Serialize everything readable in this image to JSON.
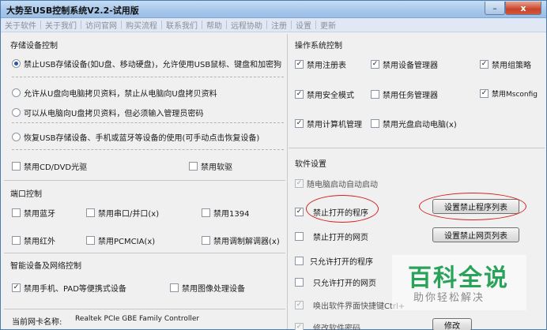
{
  "window": {
    "title": "大势至USB控制系统V2.2-试用版",
    "min_glyph": "–",
    "close_glyph": "x"
  },
  "menu": [
    "关于软件",
    "关于我们",
    "访问官网",
    "购买流程",
    "联系我们",
    "帮助",
    "远程协助",
    "注册",
    "设置",
    "更新"
  ],
  "storage": {
    "title": "存储设备控制",
    "options": [
      "禁止USB存储设备(如U盘、移动硬盘)，允许使用USB鼠标、键盘和加密狗",
      "允许从U盘向电脑拷贝资料，禁止从电脑向U盘拷贝资料",
      "可以从电脑向U盘拷贝资料，但必须输入管理员密码",
      "恢复USB存储设备、手机或蓝牙等设备的使用(可手动点击恢复设备)"
    ],
    "selected": 0,
    "cd_label": "禁用CD/DVD光驱",
    "floppy_label": "禁用软驱"
  },
  "ports": {
    "title": "端口控制",
    "items": [
      {
        "label": "禁用蓝牙",
        "checked": false
      },
      {
        "label": "禁用串口/并口(x)",
        "checked": false
      },
      {
        "label": "禁用1394",
        "checked": false
      },
      {
        "label": "禁用红外",
        "checked": false
      },
      {
        "label": "禁用PCMCIA(x)",
        "checked": false
      },
      {
        "label": "禁用调制解调器(x)",
        "checked": false
      }
    ]
  },
  "smart": {
    "title": "智能设备及网络控制",
    "items": [
      {
        "label": "禁用手机、PAD等便携式设备",
        "checked": true
      },
      {
        "label": "禁用图像处理设备",
        "checked": false
      }
    ],
    "nic_label": "当前网卡名称:",
    "nic_value": "Realtek PCIe GBE Family Controller"
  },
  "os": {
    "title": "操作系统控制",
    "items": [
      {
        "label": "禁用注册表",
        "checked": true
      },
      {
        "label": "禁用设备管理器",
        "checked": true
      },
      {
        "label": "禁用组策略",
        "checked": true
      },
      {
        "label": "禁用安全模式",
        "checked": true
      },
      {
        "label": "禁用任务管理器",
        "checked": false
      },
      {
        "label": "禁用Msconfig",
        "checked": true
      },
      {
        "label": "禁用计算机管理",
        "checked": true
      },
      {
        "label": "禁用光盘启动电脑(x)",
        "checked": false
      }
    ]
  },
  "software": {
    "title": "软件设置",
    "items": [
      {
        "label": "随电脑启动自动启动",
        "checked": true,
        "disabled": true
      },
      {
        "label": "禁止打开的程序",
        "checked": true,
        "disabled": false
      },
      {
        "label": "禁止打开的网页",
        "checked": false,
        "disabled": false
      },
      {
        "label": "只允许打开的程序",
        "checked": false,
        "disabled": false
      },
      {
        "label": "只允许打开的网页",
        "checked": false,
        "disabled": false
      },
      {
        "label": "唤出软件界面快捷键Ctrl+",
        "checked": true,
        "disabled": true
      },
      {
        "label": "修改软件密码",
        "checked": true,
        "disabled": true
      }
    ],
    "btn_program_list": "设置禁止程序列表",
    "btn_web_list": "设置禁止网页列表",
    "btn_modify": "修改"
  },
  "watermark": {
    "main": "百科全说",
    "sub": "助你轻松解决"
  }
}
